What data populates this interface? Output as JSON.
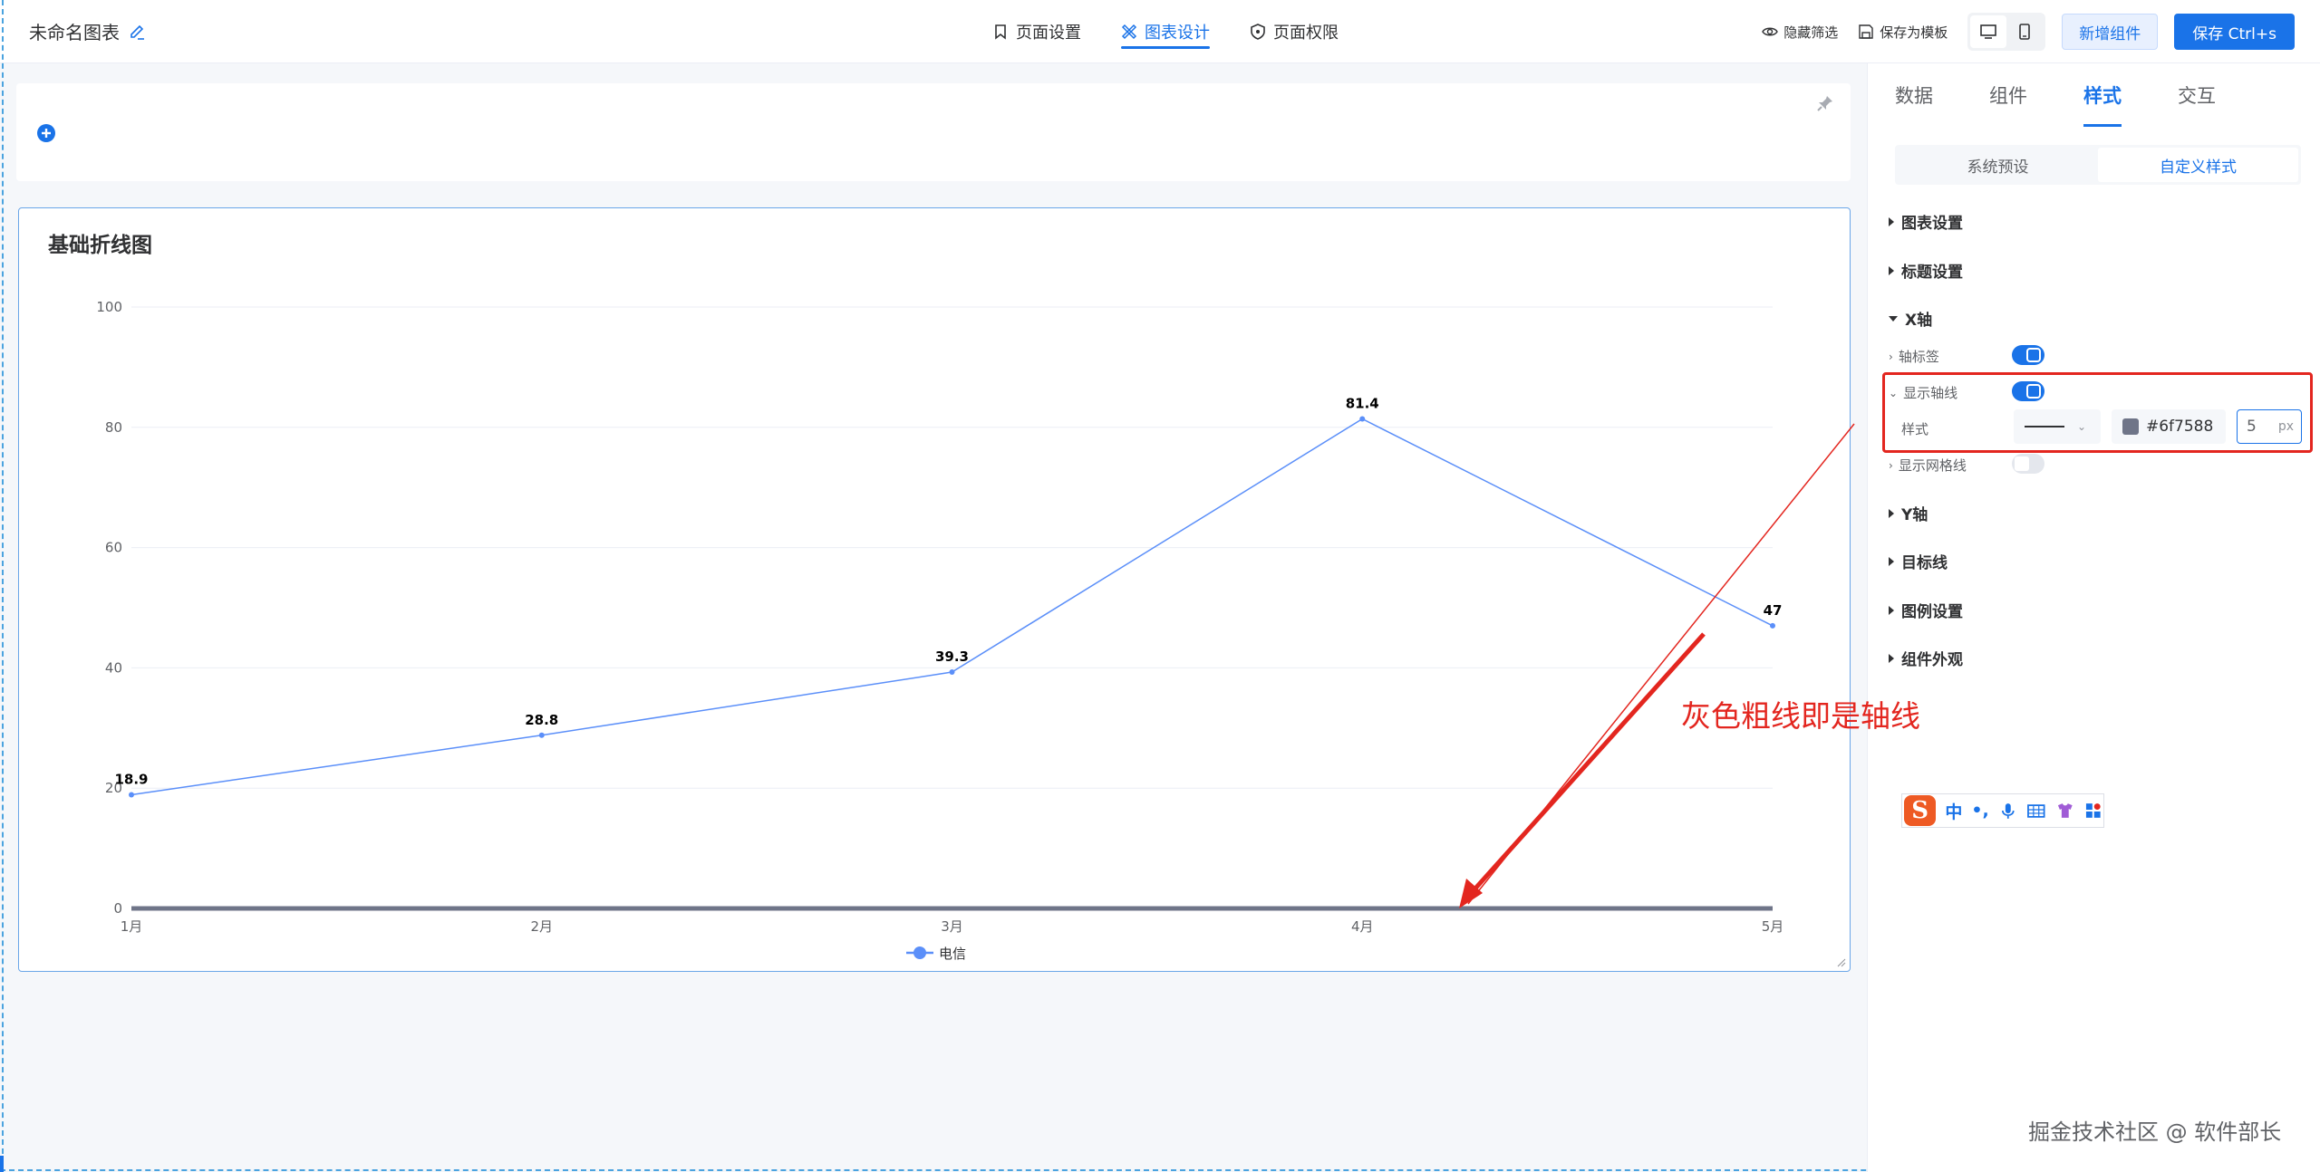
{
  "header": {
    "title": "未命名图表",
    "tabs": [
      {
        "label": "页面设置",
        "icon": "bookmark-icon"
      },
      {
        "label": "图表设计",
        "icon": "design-icon"
      },
      {
        "label": "页面权限",
        "icon": "shield-icon"
      }
    ],
    "hide_filter_label": "隐藏筛选",
    "save_template_label": "保存为模板",
    "add_component_label": "新增组件",
    "save_label": "保存 Ctrl+s"
  },
  "chart_data": {
    "type": "line",
    "title": "基础折线图",
    "categories": [
      "1月",
      "2月",
      "3月",
      "4月",
      "5月"
    ],
    "series": [
      {
        "name": "电信",
        "values": [
          18.9,
          28.8,
          39.3,
          81.4,
          47
        ]
      }
    ],
    "ylim": [
      0,
      100
    ],
    "yticks": [
      0,
      20,
      40,
      60,
      80,
      100
    ],
    "grid": true,
    "legend": "bottom-center",
    "line_color": "#5b8ff9",
    "axis_line_color": "#6f7588"
  },
  "panel": {
    "tabs": [
      "数据",
      "组件",
      "样式",
      "交互"
    ],
    "segments": [
      "系统预设",
      "自定义样式"
    ],
    "sections": {
      "chart_settings": "图表设置",
      "title_settings": "标题设置",
      "x_axis": "X轴",
      "axis_label": "轴标签",
      "show_axis_line": "显示轴线",
      "style_label": "样式",
      "axis_color": "#6f7588",
      "axis_width": "5",
      "axis_unit": "px",
      "show_grid": "显示网格线",
      "y_axis": "Y轴",
      "target_line": "目标线",
      "legend_settings": "图例设置",
      "appearance": "组件外观"
    }
  },
  "annotation": {
    "text": "灰色粗线即是轴线",
    "color": "#e3261f"
  },
  "ime": {
    "zh": "中",
    "punc": "•,"
  },
  "source_credit": "掘金技术社区 @ 软件部长"
}
